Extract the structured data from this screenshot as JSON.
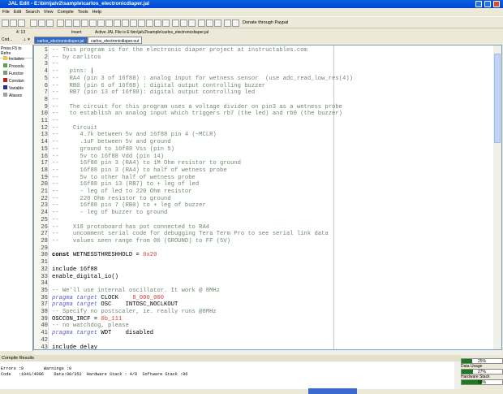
{
  "window": {
    "title": "JAL Edit - E:\\bin\\jalv2\\sample\\carlos_electronicdiaper.jal"
  },
  "menu": [
    "File",
    "Edit",
    "Search",
    "View",
    "Compile",
    "Tools",
    "Help"
  ],
  "toolbar": {
    "donate": "Donate through Paypal"
  },
  "status": {
    "position": "4: 13",
    "mode": "Insert",
    "active_file": "Active JAL File is E:\\bin\\jalv2\\sample\\carlos_electronicdiaper.jal"
  },
  "left_panel": {
    "title": "Cod...",
    "hint": "Press F5 to Refre",
    "items": [
      "Includes",
      "Procedu",
      "Functior",
      "Constan",
      "Variable",
      "Aliases"
    ]
  },
  "tabs": [
    "carlos_electronicdiaper.jal",
    "carlos_electronicdiaper.out"
  ],
  "code": [
    [
      [
        "c",
        "-- This program is for the electronic diaper project at instructables.com"
      ]
    ],
    [
      [
        "c",
        "-- by carlitos"
      ]
    ],
    [
      [
        "c",
        "--"
      ]
    ],
    [
      [
        "c",
        "--   pins: "
      ]
    ],
    [
      [
        "c",
        "--   RA4 (pin 3 of 16f88) : analog input for wetness sensor  (use adc_read_low_res(4))"
      ]
    ],
    [
      [
        "c",
        "--   RB0 (pin 6 of 16f88) : digital output controlling buzzer"
      ]
    ],
    [
      [
        "c",
        "--   RB7 (pin 13 of 16f88): digital output controlling led"
      ]
    ],
    [
      [
        "c",
        "--"
      ]
    ],
    [
      [
        "c",
        "--   The circuit for this program uses a voltage divider on pin3 as a wetness probe"
      ]
    ],
    [
      [
        "c",
        "--   to establish an analog input which triggers rb7 (the led) and rb0 (the buzzer)"
      ]
    ],
    [
      [
        "c",
        "--"
      ]
    ],
    [
      [
        "c",
        "--    Circuit"
      ]
    ],
    [
      [
        "c",
        "--      4.7k between 5v and 16f88 pin 4 (~MCLR)"
      ]
    ],
    [
      [
        "c",
        "--      .1uF between 5v and ground"
      ]
    ],
    [
      [
        "c",
        "--      ground to 16f88 Vss (pin 5)"
      ]
    ],
    [
      [
        "c",
        "--      5v to 16f88 Vdd (pin 14)"
      ]
    ],
    [
      [
        "c",
        "--      16f88 pin 3 (RA4) to 1M Ohm resistor to ground"
      ]
    ],
    [
      [
        "c",
        "--      16f88 pin 3 (RA4) to half of wetness probe"
      ]
    ],
    [
      [
        "c",
        "--      5v to other half of wetness probe"
      ]
    ],
    [
      [
        "c",
        "--      16f88 pin 13 (RB7) to + leg of led"
      ]
    ],
    [
      [
        "c",
        "--      - leg of led to 220 Ohm resistor"
      ]
    ],
    [
      [
        "c",
        "--      220 Ohm resistor to ground"
      ]
    ],
    [
      [
        "c",
        "--      16f88 pin 7 (RB0) to + leg of buzzer"
      ]
    ],
    [
      [
        "c",
        "--      - leg of buzzer to ground"
      ]
    ],
    [
      [
        "c",
        "--"
      ]
    ],
    [
      [
        "c",
        "--    X18 protoboard has pot connected to RA4"
      ]
    ],
    [
      [
        "c",
        "--    uncomment serial code for debugging Tera Term Pro to see serial link data"
      ]
    ],
    [
      [
        "c",
        "--    values seen range from 00 (GROUND) to FF (5V)"
      ]
    ],
    [
      [
        "t",
        ""
      ]
    ],
    [
      [
        "k",
        "const"
      ],
      [
        "t",
        " WETNESSTHRESHHOLD = "
      ],
      [
        "n",
        "0x20"
      ]
    ],
    [
      [
        "t",
        ""
      ]
    ],
    [
      [
        "t",
        "include 16f88"
      ]
    ],
    [
      [
        "t",
        "enable_digital_io()"
      ]
    ],
    [
      [
        "t",
        ""
      ]
    ],
    [
      [
        "c",
        "-- We'll use internal oscillator. It work @ 8MHz"
      ]
    ],
    [
      [
        "p",
        "pragma target"
      ],
      [
        "t",
        " CLOCK    "
      ],
      [
        "n",
        "8_000_000"
      ]
    ],
    [
      [
        "p",
        "pragma target"
      ],
      [
        "t",
        " OSC    INTOSC_NOCLKOUT"
      ]
    ],
    [
      [
        "c",
        "-- Specify no postscaler, ie. really runs @8MHz"
      ]
    ],
    [
      [
        "t",
        "OSCCON_IRCF = "
      ],
      [
        "n",
        "0b_111"
      ]
    ],
    [
      [
        "c",
        "-- no watchdog, please"
      ]
    ],
    [
      [
        "p",
        "pragma target"
      ],
      [
        "t",
        " WDT    disabled"
      ]
    ],
    [
      [
        "t",
        ""
      ]
    ],
    [
      [
        "t",
        "include delay"
      ]
    ]
  ],
  "results": {
    "title": "Compile Results",
    "lines": [
      "Errors :0        Warnings :0",
      "Code   :1041/4096    Data:90/352  Hardware Stack : 4/8  Software Stack :96"
    ]
  },
  "gauges": [
    {
      "label": "",
      "value": 25,
      "text": "25%"
    },
    {
      "label": "Data Usage",
      "value": 27,
      "text": "27%"
    },
    {
      "label": "Hardware Stack",
      "value": 50,
      "text": "50%"
    }
  ],
  "colors": {
    "title": "#0a5fe0",
    "comment": "#6e8a6e",
    "number": "#d0443c",
    "pragma": "#6060c0",
    "gauge": "#1e7a1e"
  }
}
